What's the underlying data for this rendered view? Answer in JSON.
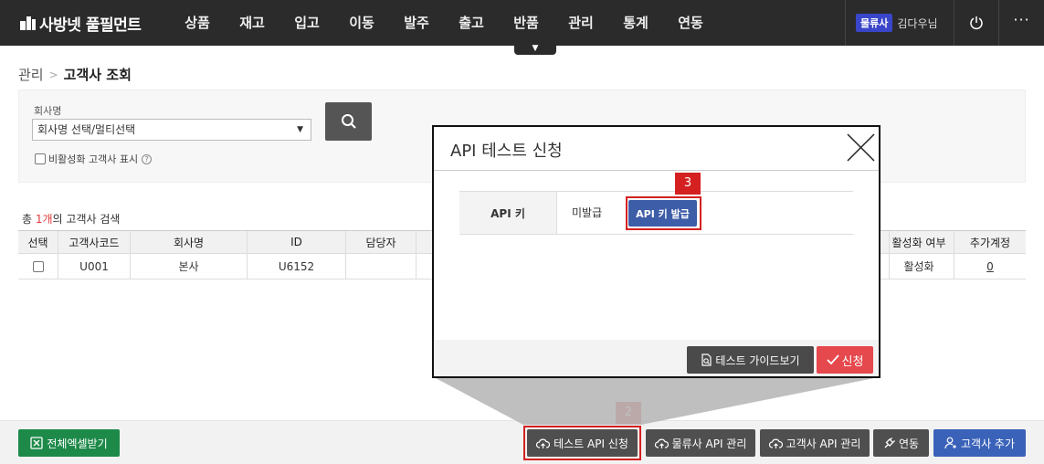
{
  "header": {
    "logo_text": "사방넷 풀필먼트",
    "nav": [
      "상품",
      "재고",
      "입고",
      "이동",
      "발주",
      "출고",
      "반품",
      "관리",
      "통계",
      "연동"
    ],
    "role_badge": "물류사",
    "user_name": "김다우님",
    "more_label": "···"
  },
  "breadcrumb": {
    "root": "관리",
    "separator": ">",
    "current": "고객사 조회"
  },
  "search": {
    "company_label": "회사명",
    "company_placeholder": "회사명 선택/멀티선택",
    "show_inactive_label": "비활성화 고객사 표시",
    "show_inactive_checked": false
  },
  "results": {
    "prefix": "총 ",
    "count": "1개",
    "suffix": "의 고객사 검색",
    "columns": [
      "선택",
      "고객사코드",
      "회사명",
      "ID",
      "담당자",
      "활성화 여부",
      "추가계정"
    ],
    "rows": [
      {
        "checked": false,
        "code": "U001",
        "company": "본사",
        "id": "U6152",
        "manager": "",
        "active": "활성화",
        "extra_accounts": "0"
      }
    ]
  },
  "modal": {
    "title": "API 테스트 신청",
    "api_key_label": "API 키",
    "api_key_status": "미발급",
    "issue_button": "API 키 발급",
    "guide_button": "테스트 가이드보기",
    "apply_button": "신청"
  },
  "bottom_bar": {
    "excel_button": "전체엑셀받기",
    "test_api_button": "테스트 API 신청",
    "logistics_api_button": "물류사 API 관리",
    "customer_api_button": "고객사 API 관리",
    "integration_button": "연동",
    "add_customer_button": "고객사 추가"
  },
  "callouts": {
    "step_2": "2",
    "step_3": "3"
  },
  "colors": {
    "topbar": "#2b2b2b",
    "role_badge": "#3a46c9",
    "count_highlight": "#e23b3b",
    "excel_green": "#1e8a4a",
    "dark_button": "#4f4f4f",
    "blue_button": "#3a62b8",
    "issue_button": "#3e5da8",
    "apply_red": "#e5484d",
    "callout_red": "#d42020"
  }
}
